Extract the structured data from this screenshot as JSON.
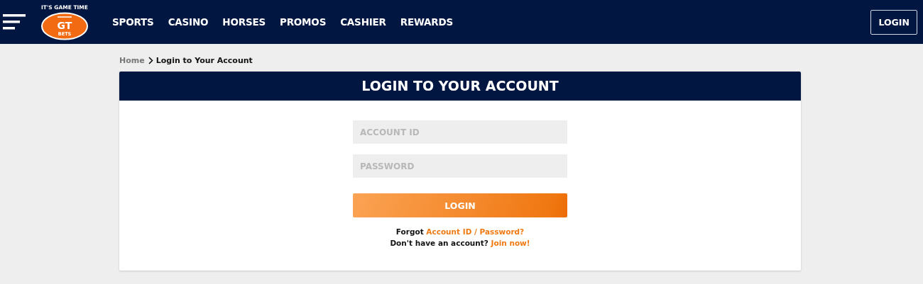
{
  "logo": {
    "tagline": "IT'S GAME TIME",
    "initials": "GT",
    "word": "BETS"
  },
  "nav": [
    "SPORTS",
    "CASINO",
    "HORSES",
    "PROMOS",
    "CASHIER",
    "REWARDS"
  ],
  "header_button": "LOGIN",
  "breadcrumb": [
    "Home",
    "Login to Your Account"
  ],
  "card": {
    "title": "LOGIN TO YOUR ACCOUNT",
    "fields": [
      {
        "placeholder": "ACCOUNT ID"
      },
      {
        "placeholder": "PASSWORD"
      }
    ],
    "submit": "LOGIN",
    "lines": [
      {
        "text": "Forgot",
        "link": "Account ID / Password?"
      },
      {
        "text": "Don't have an account?",
        "link": "Join now!"
      }
    ]
  }
}
